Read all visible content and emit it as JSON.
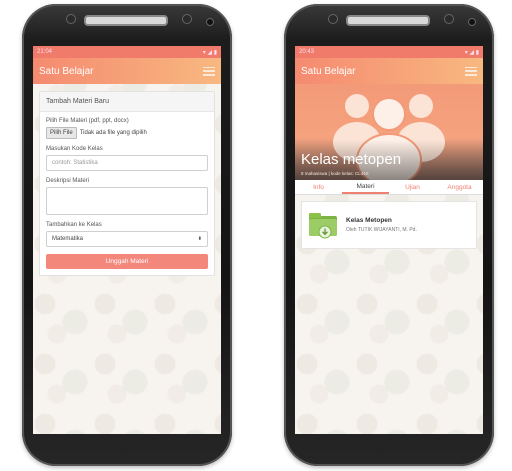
{
  "left_phone": {
    "status_time": "21:04",
    "app_title": "Satu Belajar",
    "form": {
      "header": "Tambah Materi Baru",
      "file_label": "Pilih File Materi (pdf, ppt, docx)",
      "file_button": "Pilih File",
      "file_status": "Tidak ada file yang dipilih",
      "code_label": "Masukan Kode Kelas",
      "code_placeholder": "contoh: Statistika",
      "desc_label": "Deskripsi Materi",
      "class_label": "Tambahkan ke Kelas",
      "class_selected": "Matematika",
      "submit_label": "Unggah Materi"
    }
  },
  "right_phone": {
    "status_time": "20:43",
    "app_title": "Satu Belajar",
    "hero": {
      "title": "Kelas metopen",
      "subtitle": "8 mahasiswa | kode kelas: CL44X"
    },
    "tabs": [
      "Info",
      "Materi",
      "Ujian",
      "Anggota"
    ],
    "material": {
      "title": "Kelas Metopen",
      "author": "Oleh TUTIK WIJAYANTI, M. Pd."
    }
  },
  "colors": {
    "accent": "#f4877c",
    "appbar_start": "#f58a70",
    "appbar_end": "#f8b880"
  }
}
